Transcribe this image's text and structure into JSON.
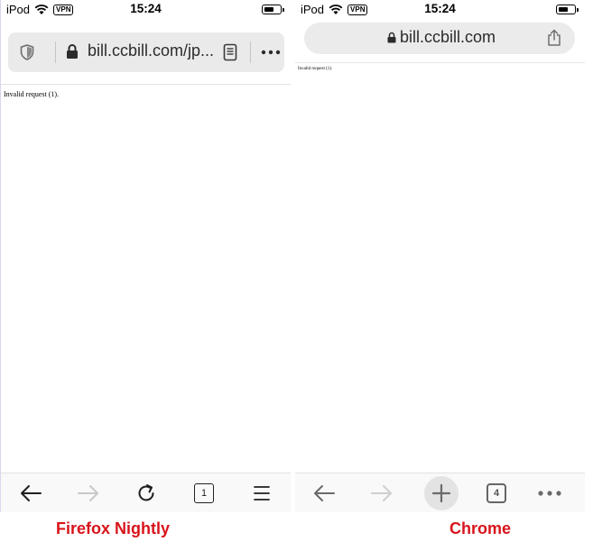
{
  "firefox": {
    "status_bar": {
      "device": "iPod",
      "vpn": "VPN",
      "time": "15:24"
    },
    "url": "bill.ccbill.com/jp...",
    "page_text": "Invalid request (1).",
    "tab_count": "1",
    "icons": [
      "shield-icon",
      "lock-icon",
      "reader-mode-icon",
      "more-icon",
      "back-icon",
      "forward-icon",
      "reload-icon",
      "tabs-icon",
      "menu-icon"
    ],
    "caption": "Firefox Nightly"
  },
  "chrome": {
    "status_bar": {
      "device": "iPod",
      "vpn": "VPN",
      "time": "15:24"
    },
    "url": "bill.ccbill.com",
    "page_text": "Invalid request (1).",
    "tab_count": "4",
    "icons": [
      "lock-icon",
      "share-icon",
      "back-icon",
      "forward-icon",
      "new-tab-icon",
      "tabs-icon",
      "more-icon"
    ],
    "caption": "Chrome"
  },
  "colors": {
    "caption": "#d8141b",
    "url_bar_bg": "#eaeaea",
    "toolbar_bg": "#f9f9f9"
  }
}
